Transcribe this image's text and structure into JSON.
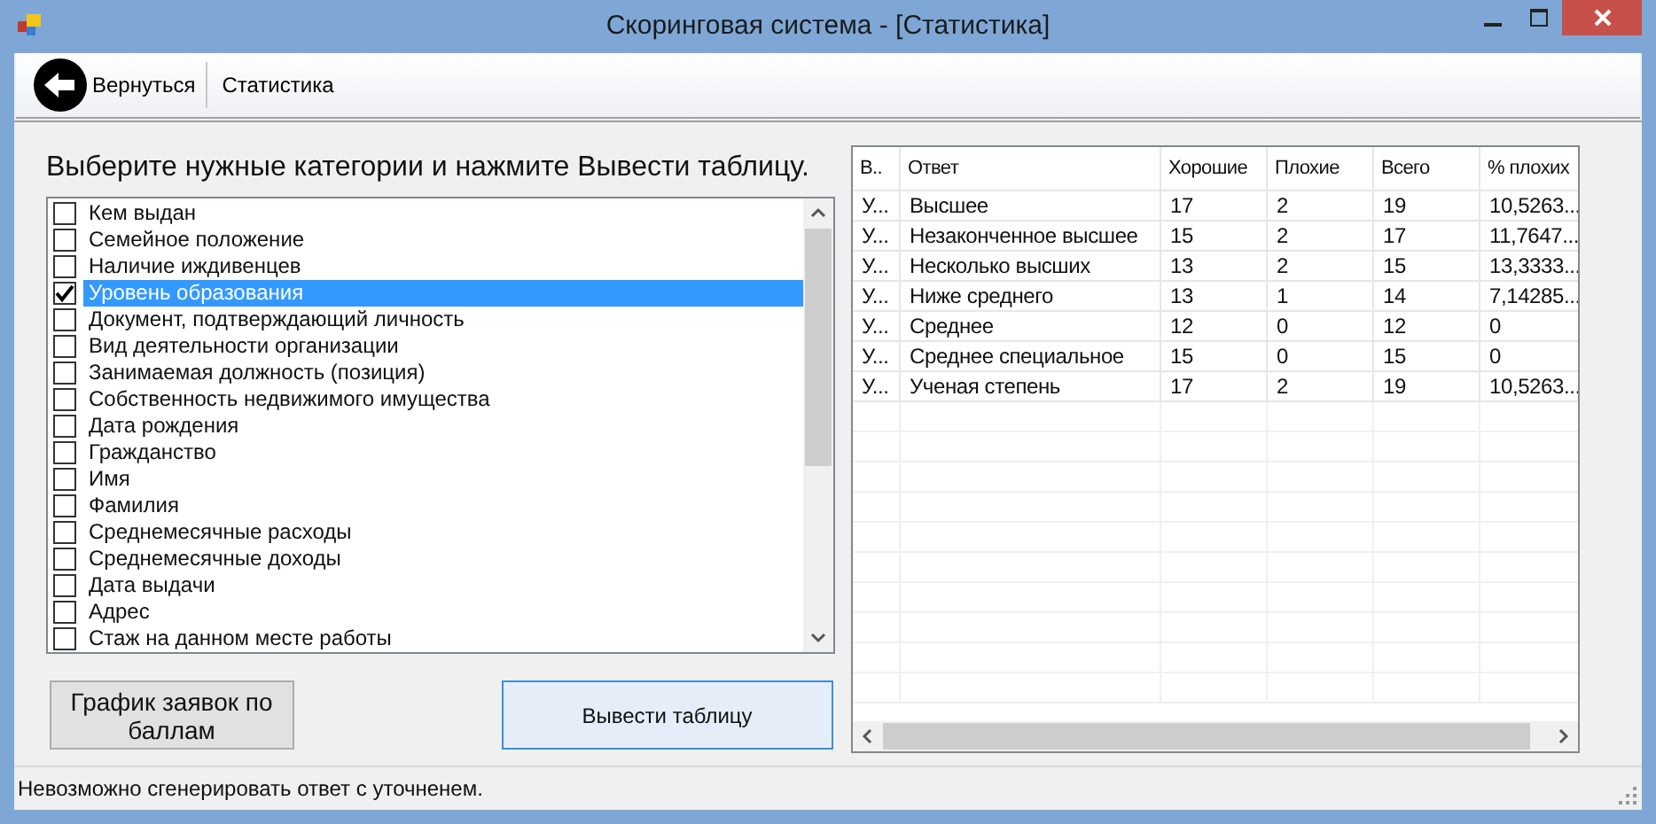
{
  "window": {
    "title": "Скоринговая система - [Статистика]"
  },
  "toolbar": {
    "back_button": "Вернуться",
    "items": [
      {
        "label": "Статистика"
      }
    ]
  },
  "instruction": "Выберите нужные категории и нажмите Вывести таблицу.",
  "categories": [
    {
      "label": "Кем выдан",
      "checked": false,
      "selected": false
    },
    {
      "label": "Семейное положение",
      "checked": false,
      "selected": false
    },
    {
      "label": "Наличие иждивенцев",
      "checked": false,
      "selected": false
    },
    {
      "label": "Уровень образования",
      "checked": true,
      "selected": true
    },
    {
      "label": "Документ, подтверждающий личность",
      "checked": false,
      "selected": false
    },
    {
      "label": "Вид деятельности организации",
      "checked": false,
      "selected": false
    },
    {
      "label": "Занимаемая должность (позиция)",
      "checked": false,
      "selected": false
    },
    {
      "label": "Собственность недвижимого имущества",
      "checked": false,
      "selected": false
    },
    {
      "label": "Дата рождения",
      "checked": false,
      "selected": false
    },
    {
      "label": "Гражданство",
      "checked": false,
      "selected": false
    },
    {
      "label": "Имя",
      "checked": false,
      "selected": false
    },
    {
      "label": "Фамилия",
      "checked": false,
      "selected": false
    },
    {
      "label": "Среднемесячные расходы",
      "checked": false,
      "selected": false
    },
    {
      "label": "Среднемесячные доходы",
      "checked": false,
      "selected": false
    },
    {
      "label": "Дата выдачи",
      "checked": false,
      "selected": false
    },
    {
      "label": "Адрес",
      "checked": false,
      "selected": false
    },
    {
      "label": "Стаж на данном месте работы",
      "checked": false,
      "selected": false
    }
  ],
  "buttons": {
    "chart": "График заявок по баллам",
    "show_table": "Вывести таблицу"
  },
  "table": {
    "columns": [
      "В..",
      "Ответ",
      "Хорошие",
      "Плохие",
      "Всего",
      "% плохих"
    ],
    "rows": [
      [
        "У...",
        "Высшее",
        "17",
        "2",
        "19",
        "10,5263..."
      ],
      [
        "У...",
        "Незаконченное высшее",
        "15",
        "2",
        "17",
        "11,7647..."
      ],
      [
        "У...",
        "Несколько высших",
        "13",
        "2",
        "15",
        "13,3333..."
      ],
      [
        "У...",
        "Ниже среднего",
        "13",
        "1",
        "14",
        "7,14285..."
      ],
      [
        "У...",
        "Среднее",
        "12",
        "0",
        "12",
        "0"
      ],
      [
        "У...",
        "Среднее специальное",
        "15",
        "0",
        "15",
        "0"
      ],
      [
        "У...",
        "Ученая степень",
        "17",
        "2",
        "19",
        "10,5263..."
      ]
    ]
  },
  "status_bar": "Невозможно сгенерировать ответ с уточненем."
}
